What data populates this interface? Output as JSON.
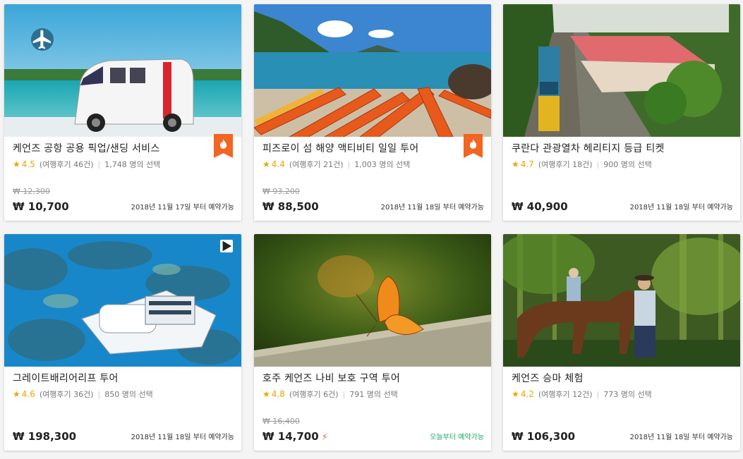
{
  "cards": [
    {
      "title": "케언즈 공항 공용 픽업/샌딩 서비스",
      "rating": "4.5",
      "reviews": "(여행후기 46건)",
      "chosen": "1,748 명의 선택",
      "original_price": "₩ 12,300",
      "price": "₩ 10,700",
      "availability": "2018년 11월 17일 부터 예약가능",
      "badges": [
        "hot-icon",
        "airplane-icon"
      ]
    },
    {
      "title": "피즈로이 섬 해양 액티비티 일일 투어",
      "rating": "4.4",
      "reviews": "(여행후기 21건)",
      "chosen": "1,003 명의 선택",
      "original_price": "₩ 93,200",
      "price": "₩ 88,500",
      "availability": "2018년 11월 18일 부터 예약가능",
      "badges": [
        "hot-icon"
      ]
    },
    {
      "title": "쿠란다 관광열차 헤리티지 등급 티켓",
      "rating": "4.7",
      "reviews": "(여행후기 18건)",
      "chosen": "900 명의 선택",
      "price": "₩ 40,900",
      "availability": "2018년 11월 18일 부터 예약가능"
    },
    {
      "title": "그레이트배리어리프 투어",
      "rating": "4.6",
      "reviews": "(여행후기 36건)",
      "chosen": "850 명의 선택",
      "price": "₩ 198,300",
      "availability": "2018년 11월 18일 부터 예약가능",
      "badges": [
        "video-icon"
      ]
    },
    {
      "title": "호주 케언즈 나비 보호 구역 투어",
      "rating": "4.8",
      "reviews": "(여행후기 6건)",
      "chosen": "791 명의 선택",
      "original_price": "₩ 16,400",
      "price": "₩ 14,700",
      "availability": "오늘부터 예약가능",
      "badges": [
        "lightning-icon"
      ]
    },
    {
      "title": "케언즈 승마 체험",
      "rating": "4.2",
      "reviews": "(여행후기 12건)",
      "chosen": "773 명의 선택",
      "price": "₩ 106,300",
      "availability": "2018년 11월 18일 부터 예약가능"
    }
  ],
  "colors": {
    "star": "#f0a400",
    "hot": "#f26522",
    "today": "#1ea86b"
  }
}
